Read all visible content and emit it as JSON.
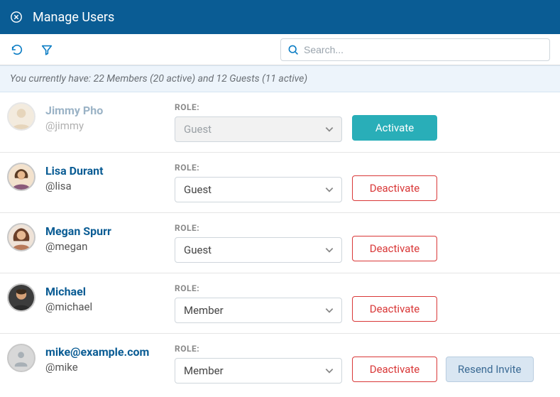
{
  "header": {
    "title": "Manage Users"
  },
  "toolbar": {
    "search_placeholder": "Search..."
  },
  "summary": {
    "text": "You currently have: 22 Members (20 active) and 12 Guests (11 active)"
  },
  "labels": {
    "role": "ROLE:"
  },
  "actions": {
    "activate": "Activate",
    "deactivate": "Deactivate",
    "resend_invite": "Resend Invite"
  },
  "users": [
    {
      "name": "Jimmy Pho",
      "handle": "@jimmy",
      "role": "Guest",
      "active": false,
      "avatar": "photo1",
      "resend": false
    },
    {
      "name": "Lisa Durant",
      "handle": "@lisa",
      "role": "Guest",
      "active": true,
      "avatar": "photo2",
      "resend": false
    },
    {
      "name": "Megan Spurr",
      "handle": "@megan",
      "role": "Guest",
      "active": true,
      "avatar": "photo3",
      "resend": false
    },
    {
      "name": "Michael",
      "handle": "@michael",
      "role": "Member",
      "active": true,
      "avatar": "photo4",
      "resend": false
    },
    {
      "name": "mike@example.com",
      "handle": "@mike",
      "role": "Member",
      "active": true,
      "avatar": "placeholder",
      "resend": true
    }
  ]
}
